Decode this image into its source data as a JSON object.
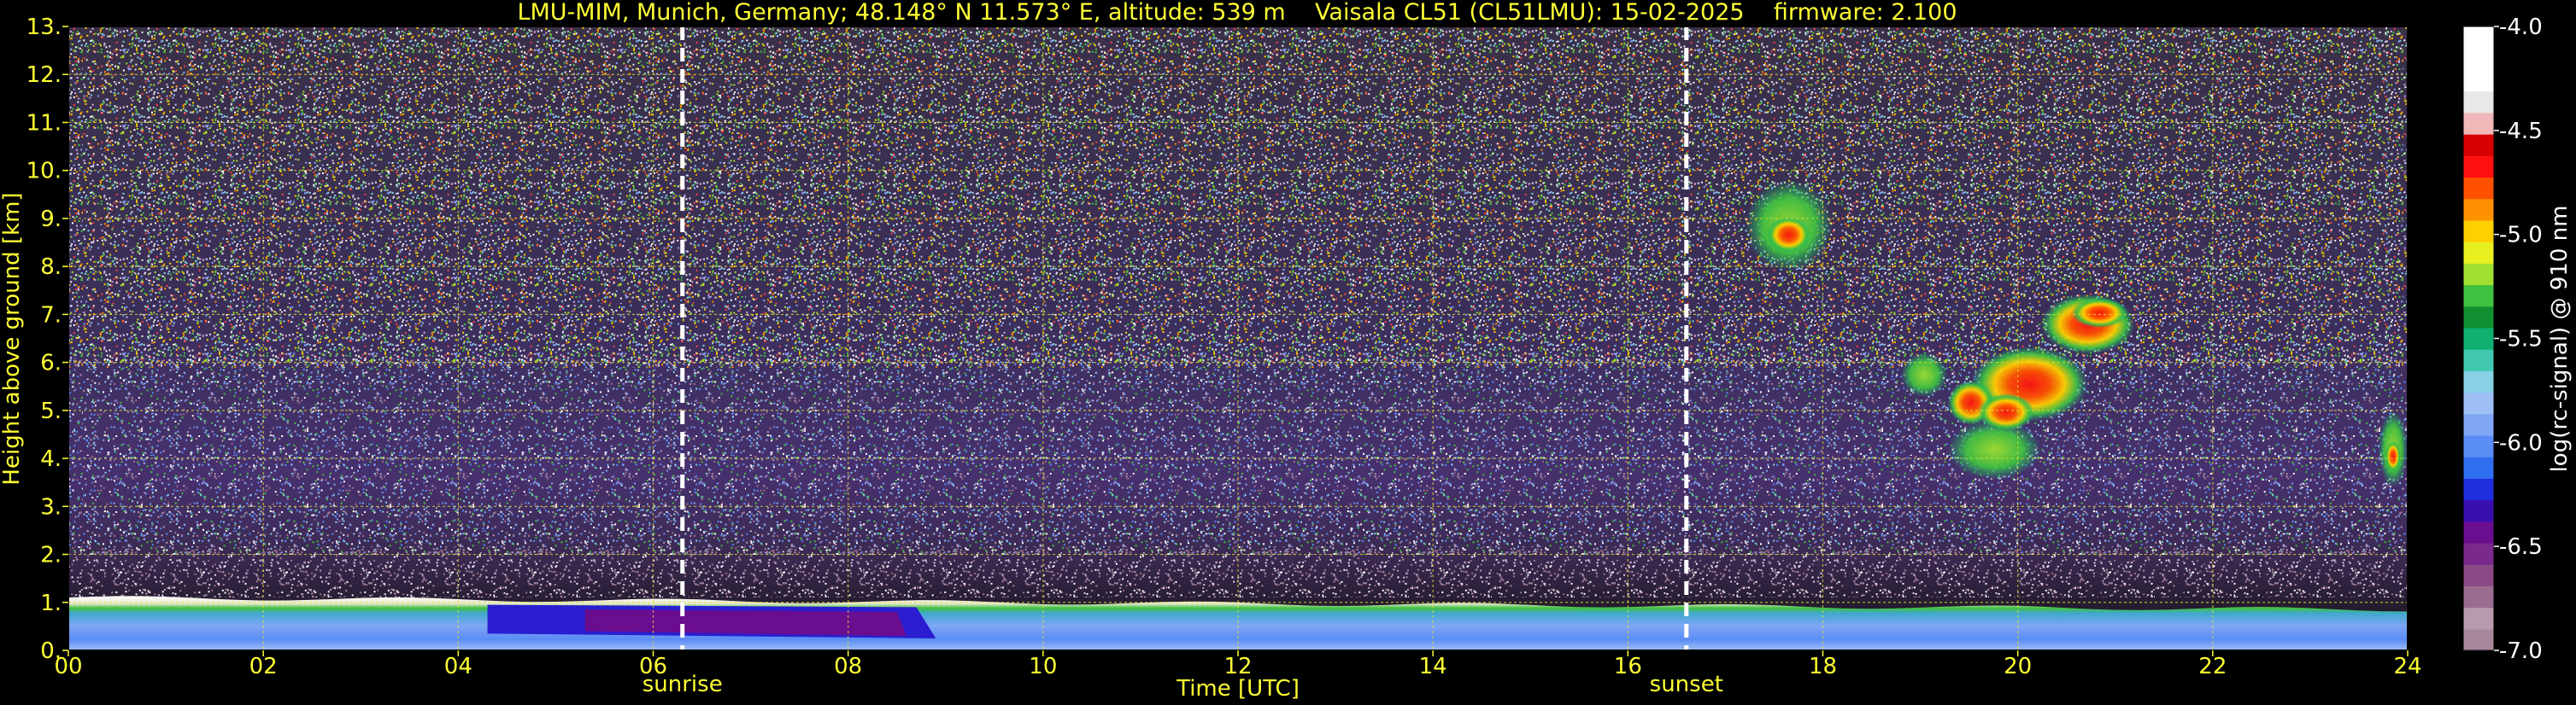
{
  "chart_data": {
    "type": "heatmap",
    "title": "LMU-MIM, Munich, Germany; 48.148° N 11.573° E, altitude: 539 m    Vaisala CL51 (CL51LMU): 15-02-2025    firmware: 2.100",
    "xlabel": "Time [UTC]",
    "ylabel": "Height above ground [km]",
    "xlim": [
      0,
      24
    ],
    "ylim": [
      0,
      13
    ],
    "x_tick_labels": [
      "00",
      "02",
      "04",
      "06",
      "08",
      "10",
      "12",
      "14",
      "16",
      "18",
      "20",
      "22",
      "24"
    ],
    "y_tick_labels": [
      "0.",
      "1.",
      "2.",
      "3.",
      "4.",
      "5.",
      "6.",
      "7.",
      "8.",
      "9.",
      "10.",
      "11.",
      "12.",
      "13."
    ],
    "grid": true,
    "markers": [
      {
        "label": "sunrise",
        "x": 6.3
      },
      {
        "label": "sunset",
        "x": 16.6
      }
    ],
    "colorbar": {
      "label": "log(rc-signal) @ 910 nm",
      "range": [
        -7.0,
        -4.0
      ],
      "tick_labels": [
        "-4.0",
        "-4.5",
        "-5.0",
        "-5.5",
        "-6.0",
        "-6.5",
        "-7.0"
      ],
      "colors": [
        "#a8889c",
        "#b89aad",
        "#9a6d8f",
        "#8a4a86",
        "#7a2a8a",
        "#6a0d8f",
        "#3a0fb0",
        "#1f2fe0",
        "#2f6ef0",
        "#5a8cf5",
        "#7fa6f5",
        "#a0c0f5",
        "#88d0e6",
        "#40c8b0",
        "#10b070",
        "#109030",
        "#40c040",
        "#a0e030",
        "#e8f020",
        "#ffd000",
        "#ff9000",
        "#ff5000",
        "#ff1010",
        "#d80000",
        "#f0b8b8",
        "#e8e8e8",
        "#ffffff",
        "#ffffff",
        "#ffffff"
      ]
    },
    "features": [
      {
        "label": "boundary layer aerosol",
        "x_range": [
          0,
          24
        ],
        "height_range": [
          0,
          1.1
        ]
      },
      {
        "label": "cloud",
        "x_range": [
          18.8,
          21.2
        ],
        "height_range": [
          3.6,
          7.5
        ]
      },
      {
        "label": "cloud",
        "x_range": [
          17.2,
          18.1
        ],
        "height_range": [
          7.9,
          9.8
        ]
      },
      {
        "label": "cloud",
        "x_range": [
          23.7,
          24.0
        ],
        "height_range": [
          3.4,
          5.0
        ]
      }
    ]
  }
}
